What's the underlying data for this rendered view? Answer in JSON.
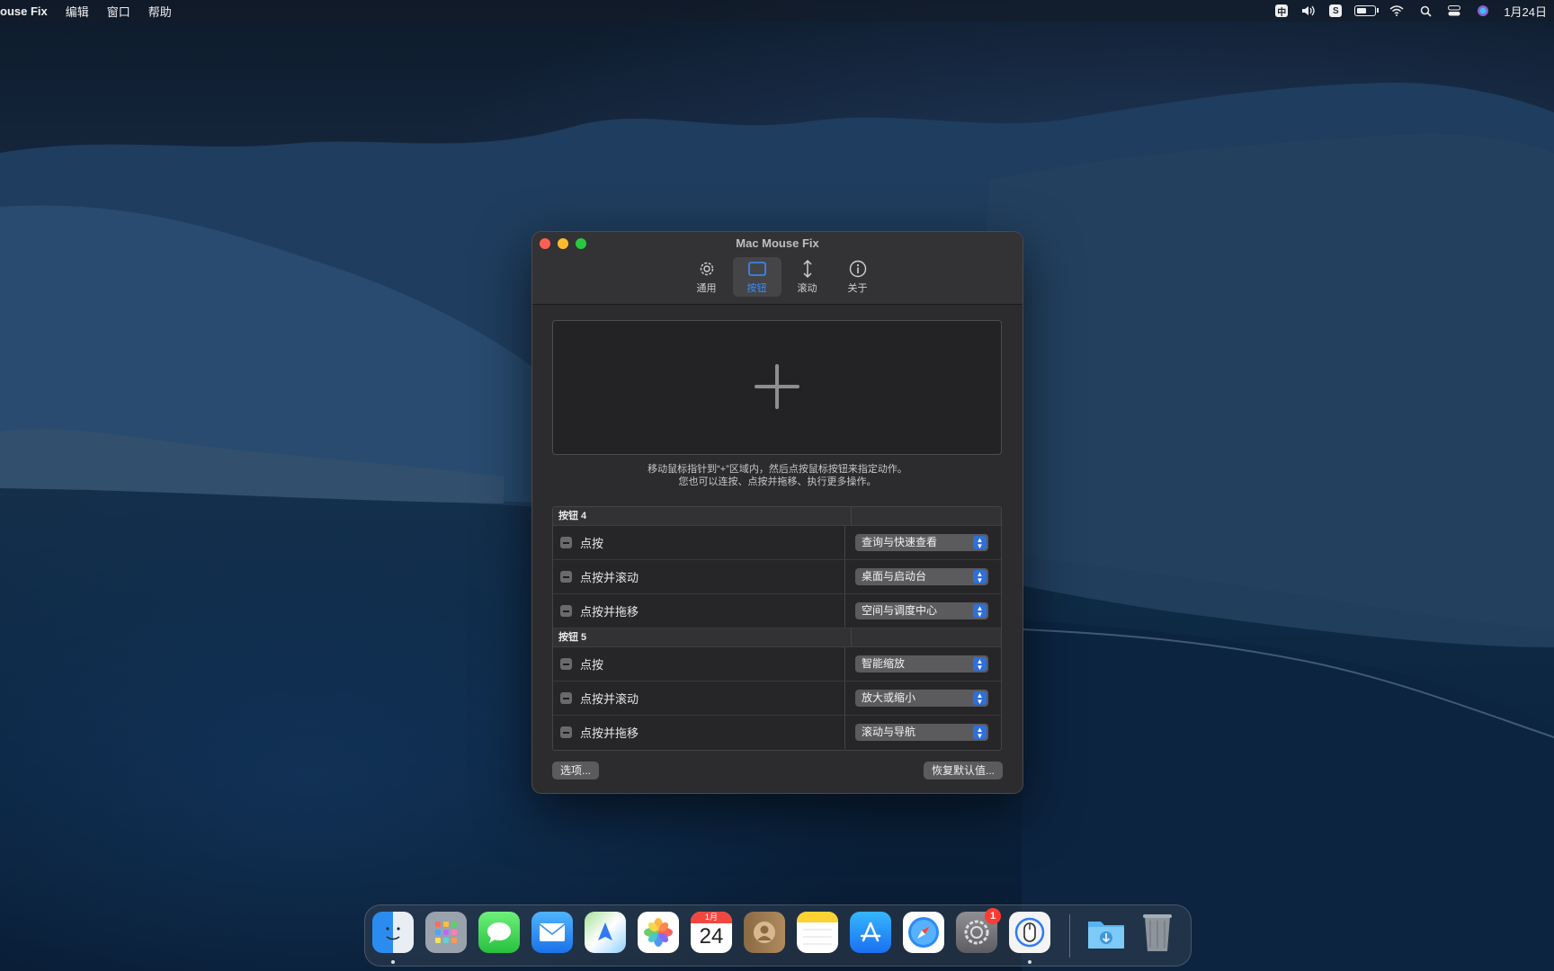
{
  "menubar": {
    "app_name": "ouse Fix",
    "menus": [
      "编辑",
      "窗口",
      "帮助"
    ],
    "input_source": "中",
    "clock": "1月24日"
  },
  "window": {
    "title": "Mac Mouse Fix",
    "tabs": [
      {
        "label": "通用",
        "icon": "gear-icon"
      },
      {
        "label": "按钮",
        "icon": "mouse-button-icon",
        "active": true
      },
      {
        "label": "滚动",
        "icon": "scroll-arrows-icon"
      },
      {
        "label": "关于",
        "icon": "info-icon"
      }
    ],
    "hint_line1": "移动鼠标指针到“+”区域内，然后点按鼠标按钮来指定动作。",
    "hint_line2": "您也可以连按、点按并拖移、执行更多操作。",
    "groups": [
      {
        "name": "按钮 4",
        "rows": [
          {
            "trigger": "点按",
            "action": "查询与快速查看"
          },
          {
            "trigger": "点按并滚动",
            "action": "桌面与启动台"
          },
          {
            "trigger": "点按并拖移",
            "action": "空间与调度中心"
          }
        ]
      },
      {
        "name": "按钮 5",
        "rows": [
          {
            "trigger": "点按",
            "action": "智能缩放"
          },
          {
            "trigger": "点按并滚动",
            "action": "放大或缩小"
          },
          {
            "trigger": "点按并拖移",
            "action": "滚动与导航"
          }
        ]
      }
    ],
    "options_button": "选项...",
    "restore_button": "恢复默认值..."
  },
  "dock": {
    "apps": [
      "Finder",
      "Launchpad",
      "Messages",
      "Mail",
      "Maps",
      "Photos",
      "Calendar",
      "Contacts",
      "Notes",
      "App Store",
      "Safari",
      "System Preferences",
      "Mac Mouse Fix",
      "Downloads",
      "Trash"
    ],
    "calendar_month": "1月",
    "calendar_day": "24",
    "system_prefs_badge": "1"
  }
}
